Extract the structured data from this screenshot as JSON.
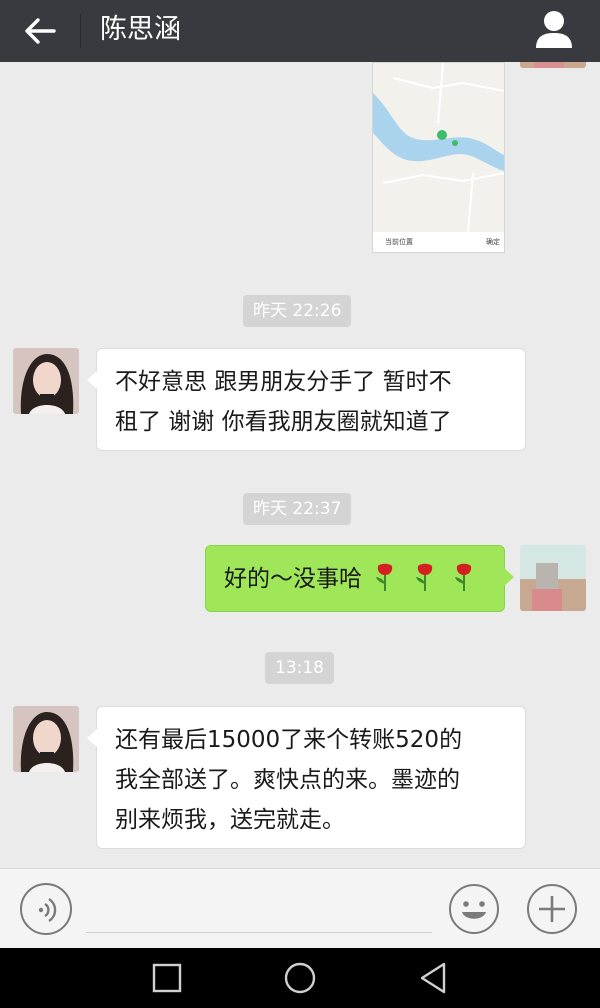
{
  "header": {
    "title": "陈思涵",
    "back_icon": "arrow-left-icon",
    "profile_icon": "person-icon"
  },
  "chat": {
    "location_message": {
      "footer_left": "当前位置",
      "footer_right": "确定"
    },
    "timestamps": [
      "昨天 22:26",
      "昨天 22:37",
      "13:18"
    ],
    "messages": [
      {
        "sender": "contact",
        "lines": [
          "不好意思 跟男朋友分手了 暂时不",
          "租了 谢谢 你看我朋友圈就知道了"
        ]
      },
      {
        "sender": "me",
        "text": "好的～没事哈",
        "emoji": [
          "rose",
          "rose",
          "rose"
        ]
      },
      {
        "sender": "contact",
        "lines": [
          "还有最后15000了来个转账520的",
          "我全部送了。爽快点的来。墨迹的",
          "别来烦我，送完就走。"
        ]
      }
    ]
  },
  "input_bar": {
    "voice_icon": "voice-icon",
    "emoji_icon": "emoji-icon",
    "more_icon": "plus-icon",
    "input_value": ""
  },
  "nav_bar": {
    "icons": [
      "recent-apps-icon",
      "home-icon",
      "back-triangle-icon"
    ]
  },
  "colors": {
    "header_bg": "#393a3f",
    "chat_bg": "#ebebeb",
    "sent_bubble": "#9fe658",
    "received_bubble": "#ffffff",
    "timestamp_bg": "#d4d4d4"
  }
}
